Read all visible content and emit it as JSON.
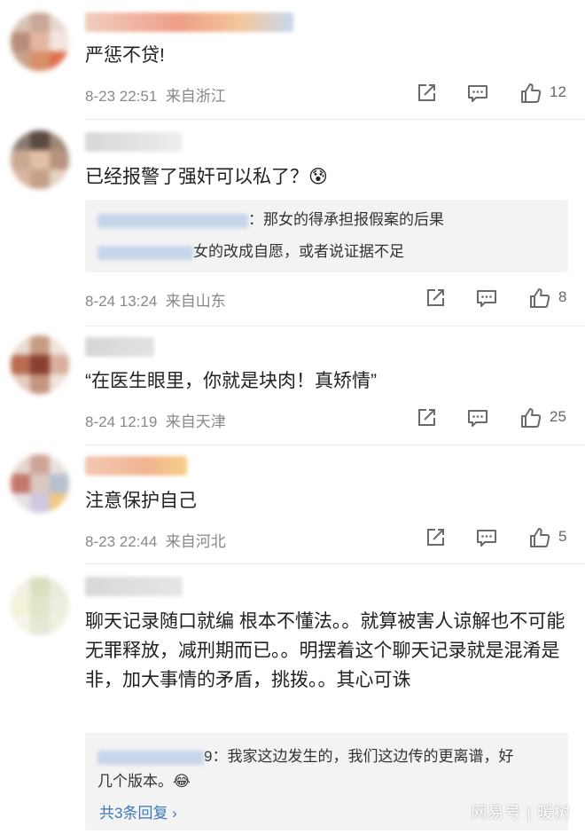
{
  "comments": [
    {
      "text": "严惩不贷!",
      "date": "8-23 22:51",
      "location": "来自浙江",
      "likes": "12",
      "avatar_colors": [
        "#d9c2b6",
        "#c8a896",
        "#e8d8cf",
        "#b88e7a",
        "#e3b7a2",
        "#f2e6de",
        "#c9a18c",
        "#d89068",
        "#e07050"
      ]
    },
    {
      "text": "已经报警了强奸可以私了？😰",
      "reply": {
        "line1_suffix": "：那女的得承担报假案的后果",
        "line2_suffix": "女的改成自愿，或者说证据不足"
      },
      "date": "8-24 13:24",
      "location": "来自山东",
      "likes": "8",
      "avatar_colors": [
        "#8a7a70",
        "#5b4a42",
        "#a08878",
        "#caa892",
        "#e2c0a8",
        "#b89480",
        "#d8b6a0",
        "#c4a088",
        "#e6d2c2"
      ]
    },
    {
      "text": "“在医生眼里，你就是块肉！真矫情”",
      "date": "8-24 12:19",
      "location": "来自天津",
      "likes": "25",
      "avatar_colors": [
        "#e9dcd2",
        "#c89c84",
        "#efe4dc",
        "#b86c50",
        "#8a4030",
        "#d8b09c",
        "#e4ccbe",
        "#c49480",
        "#f0e6de"
      ]
    },
    {
      "text": "注意保护自己",
      "date": "8-23 22:44",
      "location": "来自河北",
      "likes": "5",
      "avatar_colors": [
        "#e4d8d0",
        "#cfa498",
        "#e9e2dc",
        "#c4786c",
        "#d8c8c0",
        "#b8c0cc",
        "#e8e0e6",
        "#d0c8e0",
        "#f0c880"
      ]
    },
    {
      "text": "聊天记录随口就编 根本不懂法。。就算被害人谅解也不可能无罪释放，减刑期而已。。明摆着这个聊天记录就是混淆是非，加大事情的矛盾，挑拨。。其心可诛",
      "reply": {
        "line1_suffix": "9：我家这边发生的，我们这边传的更离谱，好",
        "line2": "几个版本。😂",
        "more": "共3条回复 ›"
      },
      "avatar_colors": [
        "#f2f0e4",
        "#d8e0c0",
        "#e8ecdc",
        "#f4f2d8",
        "#e0e6c8",
        "#ecefe0",
        "#f6f4e8",
        "#e4e8d4",
        "#f0f0e0"
      ]
    }
  ],
  "watermark": "网易号 | 暖树",
  "colors": {
    "link": "#3d78b8",
    "meta": "#888888",
    "reply_bg": "#f3f3f3"
  },
  "icons": [
    "share-icon",
    "comment-icon",
    "like-icon"
  ]
}
